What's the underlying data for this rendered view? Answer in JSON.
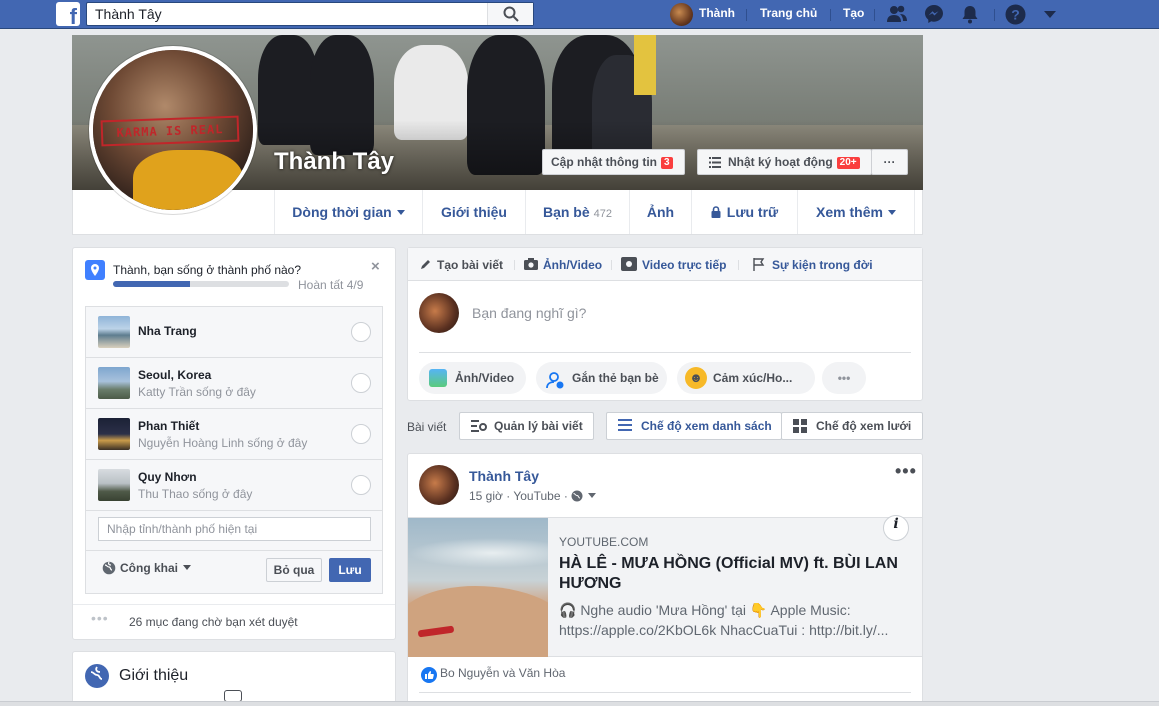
{
  "topbar": {
    "search_value": "Thành Tây",
    "user_name": "Thành",
    "home_label": "Trang chủ",
    "create_label": "Tạo",
    "logo_letter": "f"
  },
  "profile": {
    "name": "Thành Tây",
    "update_info_label": "Cập nhật thông tin",
    "update_info_badge": "3",
    "activity_log_label": "Nhật ký hoạt động",
    "activity_log_badge": "20+",
    "more_dots": "···",
    "avatar_stamp": "KARMA IS REAL"
  },
  "tabs": [
    {
      "label": "Dòng thời gian",
      "caret": true
    },
    {
      "label": "Giới thiệu"
    },
    {
      "label": "Bạn bè",
      "count": "472"
    },
    {
      "label": "Ảnh"
    },
    {
      "label": "Lưu trữ",
      "icon": "lock-icon"
    },
    {
      "label": "Xem thêm",
      "caret": true
    }
  ],
  "city_prompt": {
    "question": "Thành, bạn sống ở thành phố nào?",
    "close": "×",
    "progress_percent": 44,
    "progress_text": "Hoàn tất 4/9",
    "cities": [
      {
        "name": "Nha Trang",
        "sub": ""
      },
      {
        "name": "Seoul, Korea",
        "sub": "Katty Trần sống ở đây"
      },
      {
        "name": "Phan Thiết",
        "sub": "Nguyễn Hoàng Linh sống ở đây"
      },
      {
        "name": "Quy Nhơn",
        "sub": "Thu Thao sống ở đây"
      }
    ],
    "input_placeholder": "Nhập tỉnh/thành phố hiện tại",
    "privacy_label": "Công khai",
    "skip_label": "Bỏ qua",
    "save_label": "Lưu",
    "pending_text": "26 mục đang chờ bạn xét duyệt",
    "pending_dots": "•••"
  },
  "intro": {
    "title": "Giới thiệu"
  },
  "composer": {
    "tabs": [
      "Tạo bài viết",
      "Ảnh/Video",
      "Video trực tiếp",
      "Sự kiện trong đời"
    ],
    "placeholder": "Bạn đang nghĩ gì?",
    "actions": [
      "Ảnh/Video",
      "Gắn thẻ bạn bè",
      "Cảm xúc/Ho...",
      "•••"
    ]
  },
  "posts_bar": {
    "label": "Bài viết",
    "manage_label": "Quản lý bài viết",
    "list_view_label": "Chế độ xem danh sách",
    "grid_view_label": "Chế độ xem lưới"
  },
  "post": {
    "author": "Thành Tây",
    "time": "15 giờ",
    "via": "YouTube",
    "more": "•••",
    "link_domain": "YOUTUBE.COM",
    "link_title": "HÀ LÊ - MƯA HỒNG (Official MV) ft. BÙI LAN HƯƠNG",
    "link_desc_1": "🎧 Nghe audio 'Mưa Hồng' tại 👇 Apple Music:",
    "link_desc_2": "https://apple.co/2KbOL6k NhacCuaTui : http://bit.ly/...",
    "info": "i",
    "likes_text": "Bo Nguyễn và Văn Hòa"
  },
  "colors": {
    "brand_blue": "#4267b2",
    "link_blue": "#365899",
    "badge_red": "#fa3e3e",
    "page_bg": "#e9ebee"
  }
}
